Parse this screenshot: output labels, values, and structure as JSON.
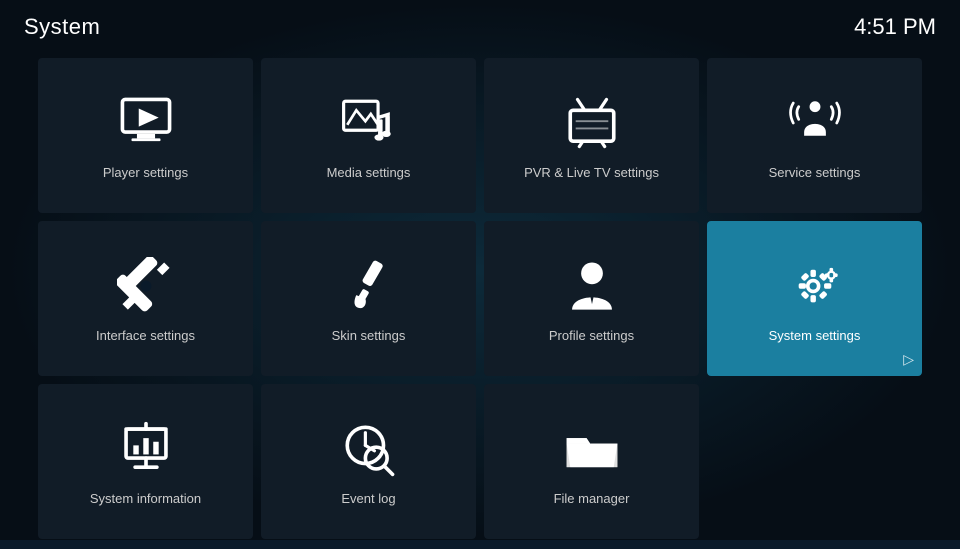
{
  "header": {
    "title": "System",
    "time": "4:51 PM"
  },
  "tiles": [
    {
      "id": "player-settings",
      "label": "Player settings",
      "icon": "player",
      "active": false
    },
    {
      "id": "media-settings",
      "label": "Media settings",
      "icon": "media",
      "active": false
    },
    {
      "id": "pvr-settings",
      "label": "PVR & Live TV settings",
      "icon": "pvr",
      "active": false
    },
    {
      "id": "service-settings",
      "label": "Service settings",
      "icon": "service",
      "active": false
    },
    {
      "id": "interface-settings",
      "label": "Interface settings",
      "icon": "interface",
      "active": false
    },
    {
      "id": "skin-settings",
      "label": "Skin settings",
      "icon": "skin",
      "active": false
    },
    {
      "id": "profile-settings",
      "label": "Profile settings",
      "icon": "profile",
      "active": false
    },
    {
      "id": "system-settings",
      "label": "System settings",
      "icon": "system",
      "active": true
    },
    {
      "id": "system-information",
      "label": "System information",
      "icon": "sysinfo",
      "active": false
    },
    {
      "id": "event-log",
      "label": "Event log",
      "icon": "eventlog",
      "active": false
    },
    {
      "id": "file-manager",
      "label": "File manager",
      "icon": "filemanager",
      "active": false
    }
  ]
}
